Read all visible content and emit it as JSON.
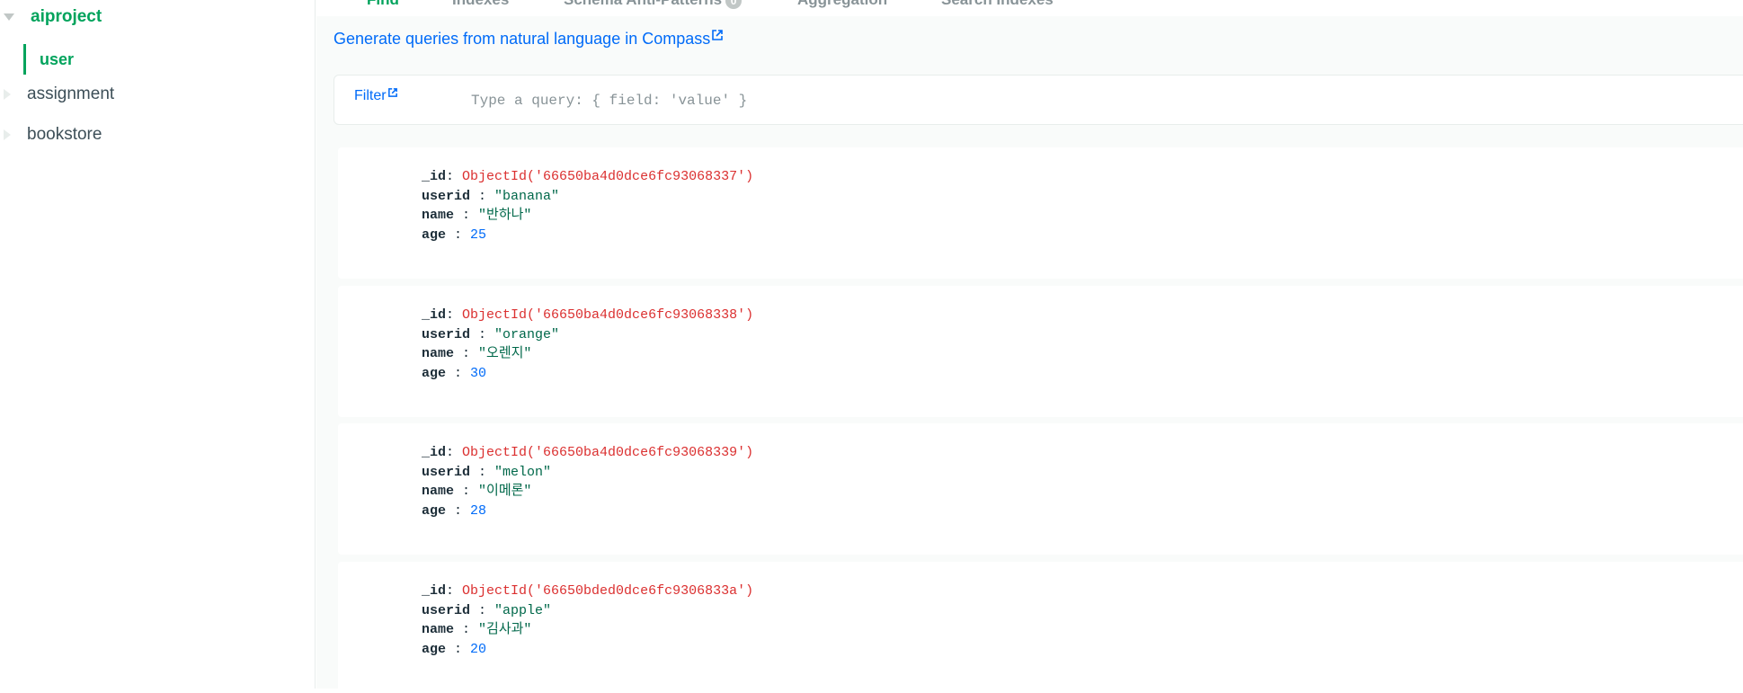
{
  "sidebar": {
    "databases": [
      {
        "name": "aiproject",
        "expanded": true,
        "active": true
      },
      {
        "name": "assignment",
        "expanded": false,
        "active": false
      },
      {
        "name": "bookstore",
        "expanded": false,
        "active": false
      }
    ],
    "active_collection": "user"
  },
  "tabs": [
    {
      "label": "Find",
      "active": true
    },
    {
      "label": "Indexes",
      "active": false
    },
    {
      "label": "Schema Anti-Patterns",
      "active": false,
      "badge": "0"
    },
    {
      "label": "Aggregation",
      "active": false
    },
    {
      "label": "Search Indexes",
      "active": false
    }
  ],
  "nl_link": "Generate queries from natural language in Compass",
  "filter": {
    "label": "Filter",
    "placeholder": "Type a query: { field: 'value' }",
    "value": ""
  },
  "documents": [
    {
      "_id": "ObjectId('66650ba4d0dce6fc93068337')",
      "userid": "\"banana\"",
      "name": "\"반하나\"",
      "age": "25"
    },
    {
      "_id": "ObjectId('66650ba4d0dce6fc93068338')",
      "userid": "\"orange\"",
      "name": "\"오렌지\"",
      "age": "30"
    },
    {
      "_id": "ObjectId('66650ba4d0dce6fc93068339')",
      "userid": "\"melon\"",
      "name": "\"이메론\"",
      "age": "28"
    },
    {
      "_id": "ObjectId('66650bded0dce6fc9306833a')",
      "userid": "\"apple\"",
      "name": "\"김사과\"",
      "age": "20"
    }
  ],
  "field_keys": {
    "id": "_id",
    "userid": "userid",
    "name": "name",
    "age": "age"
  },
  "colors": {
    "accent_green": "#00a35c",
    "link_blue": "#016bf8",
    "objectid_red": "#db3030",
    "string_green": "#00684a"
  }
}
